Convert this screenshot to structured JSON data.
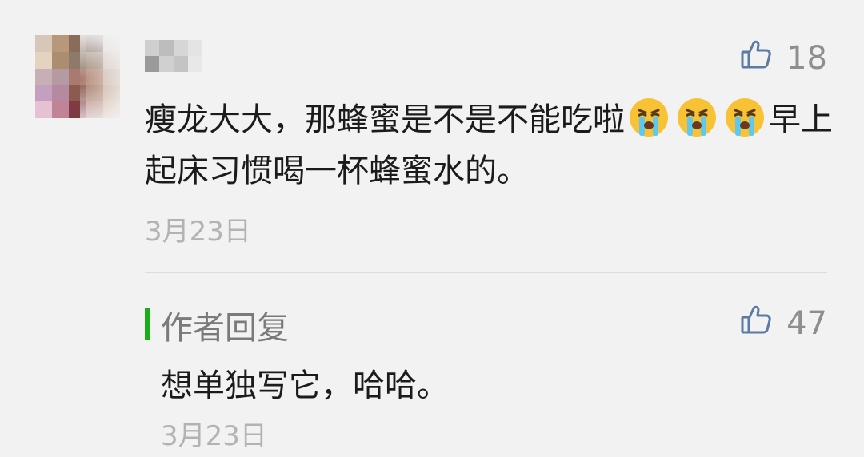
{
  "comment": {
    "username": "",
    "like_count": "18",
    "text_part1": "瘦龙大大，那蜂蜜是不是不能吃啦",
    "text_part2": "早上起床习惯喝一杯蜂蜜水的。",
    "emoji": "crying-face",
    "date": "3月23日"
  },
  "reply": {
    "label": "作者回复",
    "like_count": "47",
    "text": "想单独写它，哈哈。",
    "date": "3月23日"
  },
  "colors": {
    "background": "#f2f2f2",
    "reply_accent": "#1aad19",
    "like_icon": "#5b7ba3",
    "meta_text": "#b3b3b3"
  }
}
